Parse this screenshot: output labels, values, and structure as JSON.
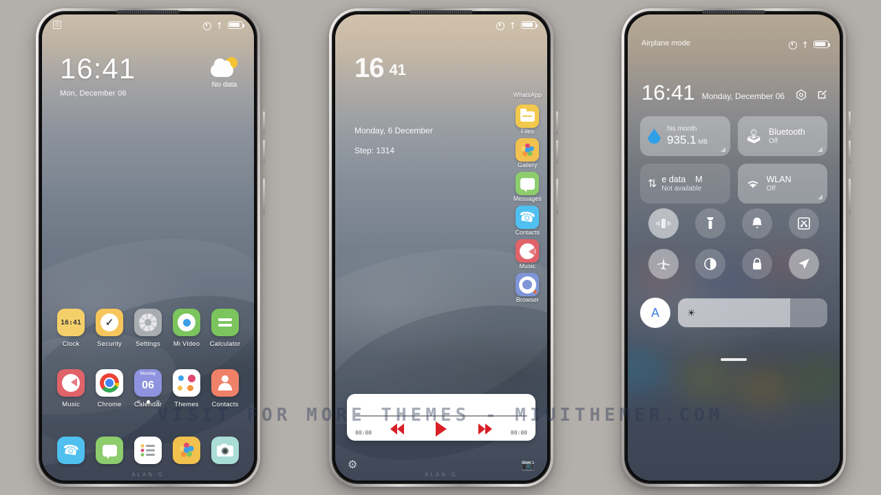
{
  "canvas": {
    "background": "#b3afab"
  },
  "watermark": {
    "text": "VISIT  FOR  MORE  THEMES  -  MIUITHEMER.COM"
  },
  "status_bar": {
    "alarm_icon": "alarm-clock-icon",
    "airplane_icon": "airplane-icon",
    "battery_icon": "battery-icon",
    "notification_icon": "screenshot-notification-icon"
  },
  "phone1": {
    "name": "lockscreen-home",
    "clock": {
      "time": "16:41",
      "date": "Mon, December 06"
    },
    "weather": {
      "icon": "partly-cloudy-icon",
      "text": "No data"
    },
    "apps_row1": [
      {
        "label": "Clock",
        "icon": "clock-icon",
        "badge": "16:41"
      },
      {
        "label": "Security",
        "icon": "security-shield-icon"
      },
      {
        "label": "Settings",
        "icon": "gear-icon"
      },
      {
        "label": "Mi Video",
        "icon": "video-reel-icon"
      },
      {
        "label": "Calculator",
        "icon": "calculator-icon"
      }
    ],
    "apps_row2": [
      {
        "label": "Music",
        "icon": "music-disc-icon"
      },
      {
        "label": "Chrome",
        "icon": "chrome-icon"
      },
      {
        "label": "Calendar",
        "icon": "calendar-icon",
        "day_name": "Monday",
        "day_num": "06"
      },
      {
        "label": "Themes",
        "icon": "themes-icon"
      },
      {
        "label": "Contacts",
        "icon": "contacts-icon"
      }
    ],
    "dock": [
      {
        "label": "Phone",
        "icon": "phone-icon"
      },
      {
        "label": "Messages",
        "icon": "messages-icon"
      },
      {
        "label": "Notes",
        "icon": "notes-icon"
      },
      {
        "label": "Gallery",
        "icon": "gallery-icon"
      },
      {
        "label": "Camera",
        "icon": "camera-icon"
      }
    ],
    "page_indicator": {
      "count": 3,
      "active": 1
    },
    "brand": "ALAN·G"
  },
  "phone2": {
    "name": "lockscreen-widgets",
    "clock": {
      "hour": "16",
      "minute": "41"
    },
    "date": "Monday, 6 December",
    "step": "Step:  1314",
    "rail": [
      {
        "label": "WhatsApp",
        "icon": "whatsapp-icon"
      },
      {
        "label": "Files",
        "icon": "files-folder-icon"
      },
      {
        "label": "Gallery",
        "icon": "gallery-icon"
      },
      {
        "label": "Messages",
        "icon": "messages-icon"
      },
      {
        "label": "Contacts",
        "icon": "phone-contacts-icon"
      },
      {
        "label": "Music",
        "icon": "music-disc-icon"
      },
      {
        "label": "Browser",
        "icon": "browser-icon"
      }
    ],
    "player": {
      "elapsed": "00:00",
      "remaining": "00:00",
      "prev_icon": "rewind-icon",
      "play_icon": "play-icon",
      "next_icon": "fast-forward-icon",
      "accent": "#d81f26"
    },
    "bottom_left_icon": "gear-icon",
    "bottom_right_icon": "camera-icon",
    "brand": "ALAN·G"
  },
  "phone3": {
    "name": "control-center",
    "airplane_label": "Airplane mode",
    "clock": {
      "time": "16:41",
      "date": "Monday, December 06"
    },
    "actions": [
      {
        "icon": "settings-hexagon-icon"
      },
      {
        "icon": "edit-square-icon"
      }
    ],
    "tiles": [
      {
        "name": "data-usage",
        "icon": "data-drop-icon",
        "title": "his month",
        "value": "935.1",
        "unit": "MB",
        "active": true
      },
      {
        "name": "bluetooth",
        "icon": "bluetooth-icon",
        "title": "Bluetooth",
        "subtitle": "Off",
        "active": true
      },
      {
        "name": "mobile-data",
        "icon": "data-arrows-icon",
        "title": "e data",
        "title_extra": "M",
        "subtitle": "Not available",
        "active": false
      },
      {
        "name": "wlan",
        "icon": "wifi-icon",
        "title": "WLAN",
        "subtitle": "Off",
        "active": true
      }
    ],
    "toggles": [
      {
        "name": "vibrate",
        "icon": "vibrate-icon",
        "state": "on"
      },
      {
        "name": "flashlight",
        "icon": "flashlight-icon",
        "state": "off"
      },
      {
        "name": "ringer",
        "icon": "bell-icon",
        "state": "off"
      },
      {
        "name": "screenshot",
        "icon": "screenshot-scissors-icon",
        "state": "off"
      },
      {
        "name": "airplane-mode",
        "icon": "airplane-icon",
        "state": "on"
      },
      {
        "name": "dark-mode",
        "icon": "contrast-icon",
        "state": "off"
      },
      {
        "name": "lock",
        "icon": "lock-icon",
        "state": "off"
      },
      {
        "name": "location",
        "icon": "location-arrow-icon",
        "state": "on"
      }
    ],
    "brightness": {
      "auto_label": "A",
      "icon": "brightness-sun-icon",
      "level": 75
    },
    "handle": "drag-handle"
  }
}
